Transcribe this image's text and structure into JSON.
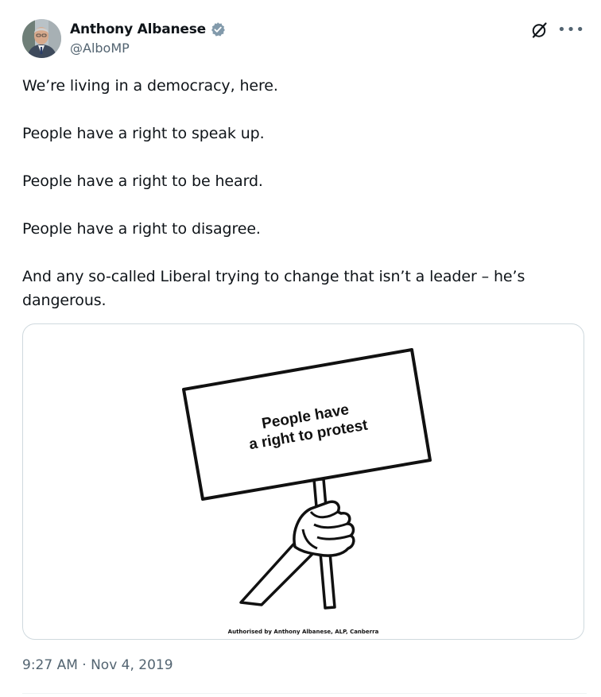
{
  "author": {
    "display_name": "Anthony Albanese",
    "handle": "@AlboMP",
    "verified": true
  },
  "icons": {
    "avatar": "avatar-photo",
    "verified": "verified-badge-icon",
    "grok": "grok-icon",
    "more": "more-icon"
  },
  "colors": {
    "verified_badge": "#829aab",
    "secondary_text": "#536471"
  },
  "tweet": {
    "paragraphs": [
      "We’re living in a democracy, here.",
      "People have a right to speak up.",
      "People have a right to be heard.",
      "People have a right to disagree.",
      "And any so-called Liberal trying to change that isn’t a leader – he’s dangerous."
    ],
    "timestamp": "9:27 AM · Nov 4, 2019"
  },
  "media": {
    "sign_line_1": "People have",
    "sign_line_2": "a right to protest",
    "authorisation": "Authorised by Anthony Albanese, ALP, Canberra"
  }
}
